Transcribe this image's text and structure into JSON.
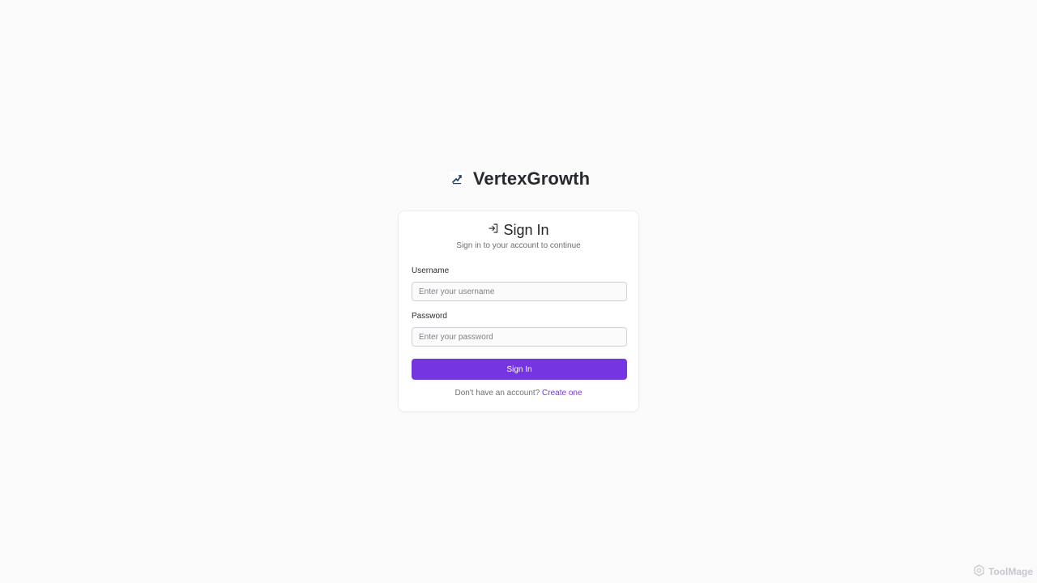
{
  "brand": {
    "name": "VertexGrowth",
    "logo_icon": "rising-chart-logo-icon"
  },
  "card": {
    "icon": "login-arrow-icon",
    "title": "Sign In",
    "subtitle": "Sign in to your account to continue",
    "username": {
      "label": "Username",
      "placeholder": "Enter your username",
      "value": ""
    },
    "password": {
      "label": "Password",
      "placeholder": "Enter your password",
      "value": ""
    },
    "submit_label": "Sign In",
    "footer": {
      "prompt": "Don't have an account?",
      "link_label": "Create one"
    }
  },
  "watermark": {
    "text": "ToolMage",
    "icon": "hexagon-logo-icon"
  },
  "colors": {
    "accent": "#7535e0",
    "background": "#fafafa",
    "card": "#ffffff"
  }
}
